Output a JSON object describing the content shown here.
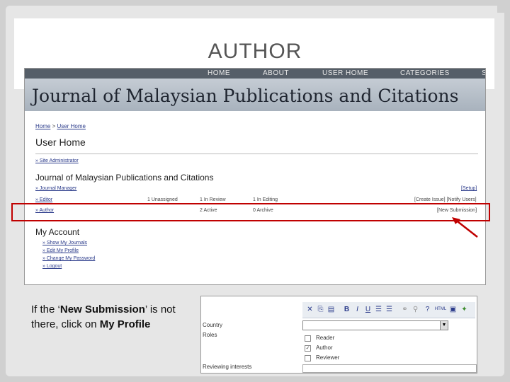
{
  "slide": {
    "title": "AUTHOR",
    "caption": {
      "prefix": "If the ‘",
      "bold1": "New Submission",
      "middle": "’ is not there, click on ",
      "bold2": "My Profile"
    }
  },
  "screenshot": {
    "nav": [
      "HOME",
      "ABOUT",
      "USER HOME",
      "CATEGORIES",
      "S"
    ],
    "banner_title": "Journal of Malaysian Publications and Citations",
    "breadcrumb": [
      "Home",
      "User Home"
    ],
    "breadcrumb_sep": ">",
    "heading": "User Home",
    "site_admin": "» Site Administrator",
    "journal_title": "Journal of Malaysian Publications and Citations",
    "journal_manager": "» Journal Manager",
    "setup": "[Setup]",
    "editor_row": {
      "role": "» Editor",
      "c1": "1 Unassigned",
      "c2": "1 In Review",
      "c3": "1 In Editing",
      "action": "[Create Issue] [Notify Users]"
    },
    "author_row": {
      "role": "» Author",
      "c1": "2 Active",
      "c2": "0 Archive",
      "action": "[New Submission]"
    },
    "account_heading": "My Account",
    "account_links": [
      "» Show My Journals",
      "» Edit My Profile",
      "» Change My Password",
      "» Logout"
    ]
  },
  "form": {
    "country_label": "Country",
    "roles_label": "Roles",
    "reviewing_label": "Reviewing interests",
    "roles": [
      {
        "label": "Reader",
        "checked": false
      },
      {
        "label": "Author",
        "checked": true
      },
      {
        "label": "Reviewer",
        "checked": false
      }
    ],
    "toolbar": [
      "✕",
      "⎘",
      "▤",
      "B",
      "I",
      "U",
      "☰",
      "☰",
      "⚭",
      "⚲",
      "?",
      "HTML",
      "▣",
      "✦"
    ]
  },
  "colors": {
    "highlight": "#c00000",
    "nav_bg": "#555e68",
    "banner": "#b5bec8",
    "link": "#2a3a8a"
  }
}
